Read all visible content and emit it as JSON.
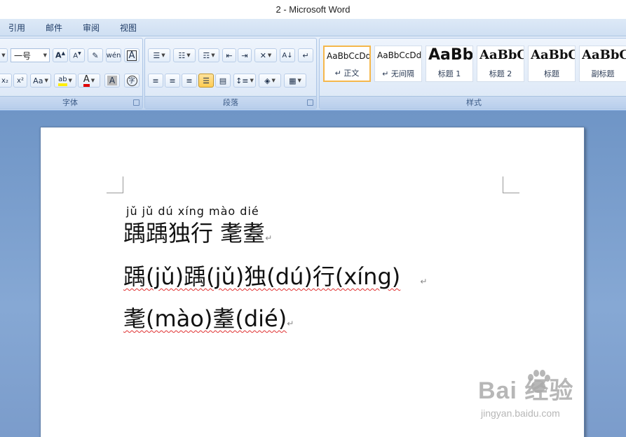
{
  "window": {
    "title": "2 - Microsoft Word"
  },
  "menu": {
    "tabs": [
      "引用",
      "邮件",
      "审阅",
      "视图"
    ]
  },
  "ribbon": {
    "font_group": {
      "label": "字体",
      "font_size": "一号"
    },
    "paragraph_group": {
      "label": "段落"
    },
    "styles_group": {
      "label": "样式",
      "cards": [
        {
          "sample": "AaBbCcDd",
          "name": "↵ 正文"
        },
        {
          "sample": "AaBbCcDd",
          "name": "↵ 无间隔"
        },
        {
          "sample": "AaBb",
          "name": "标题 1"
        },
        {
          "sample": "AaBbC",
          "name": "标题 2"
        },
        {
          "sample": "AaBbC",
          "name": "标题"
        },
        {
          "sample": "AaBbC",
          "name": "副标题"
        }
      ]
    }
  },
  "document": {
    "line1_pinyin": "jǔ jǔ dú xíng  mào dié",
    "line1_hanzi": "踽踽独行  耄耋",
    "line2": "踽(jǔ)踽(jǔ)独(dú)行(xíng)",
    "line3": "耄(mào)耋(dié)",
    "paragraph_mark": "↵"
  },
  "watermark": {
    "main": "Bai  经验",
    "sub": "jingyan.baidu.com"
  }
}
